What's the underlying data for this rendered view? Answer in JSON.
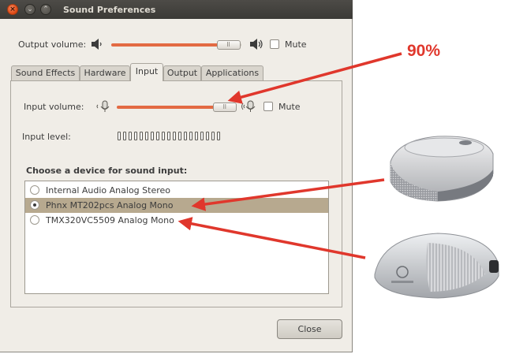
{
  "window": {
    "title": "Sound Preferences",
    "close_glyph": "×",
    "minimize_glyph": "⌄",
    "maximize_glyph": "⌃"
  },
  "output": {
    "label": "Output volume:",
    "level_percent": 90,
    "mute_label": "Mute",
    "mute_checked": false
  },
  "tabs": [
    {
      "label": "Sound Effects",
      "active": false
    },
    {
      "label": "Hardware",
      "active": false
    },
    {
      "label": "Input",
      "active": true
    },
    {
      "label": "Output",
      "active": false
    },
    {
      "label": "Applications",
      "active": false
    }
  ],
  "input": {
    "label": "Input volume:",
    "level_percent": 90,
    "mute_label": "Mute",
    "mute_checked": false,
    "level_label": "Input level:",
    "level_segments": 19,
    "level_lit": 0
  },
  "devices": {
    "heading": "Choose a device for sound input:",
    "items": [
      {
        "label": "Internal Audio Analog Stereo",
        "selected": false
      },
      {
        "label": "Phnx MT202pcs  Analog Mono",
        "selected": true
      },
      {
        "label": "TMX320VC5509 Analog Mono",
        "selected": false
      }
    ]
  },
  "close_button": {
    "label": "Close"
  },
  "annotation": {
    "label": "90%",
    "color": "#e0372c"
  },
  "colors": {
    "slider_fill": "#e36a43",
    "selection": "#b7a98f",
    "titlebar": "#3c3b37",
    "close_button": "#dd4814"
  },
  "icons": [
    "speaker-low-icon",
    "speaker-high-icon",
    "microphone-low-icon",
    "microphone-high-icon"
  ]
}
